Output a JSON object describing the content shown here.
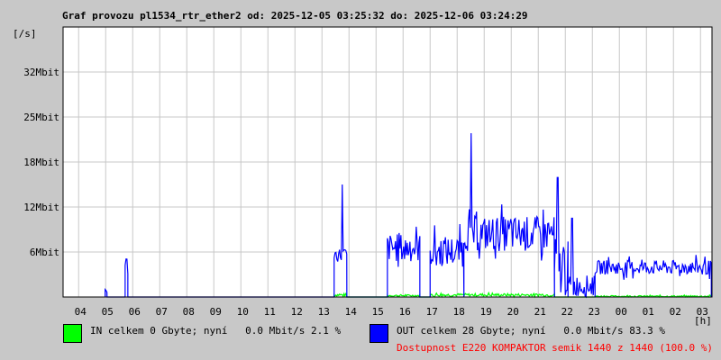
{
  "title": "Graf provozu pl1534_rtr_ether2 od: 2025-12-05 03:25:32 do: 2025-12-06 03:24:29",
  "chart_data": {
    "type": "line",
    "title": "Graf provozu pl1534_rtr_ether2 od: 2025-12-05 03:25:32 do: 2025-12-06 03:24:29",
    "ylabel": "[/s]",
    "xlabel": "[h]",
    "ylim": [
      0,
      38.4
    ],
    "x_start_hour": 3.425,
    "x_span_hours": 24,
    "y_ticks": [
      {
        "value": 6.4,
        "label": "6Mbit"
      },
      {
        "value": 12.8,
        "label": "12Mbit"
      },
      {
        "value": 19.2,
        "label": "18Mbit"
      },
      {
        "value": 25.6,
        "label": "25Mbit"
      },
      {
        "value": 32.0,
        "label": "32Mbit"
      }
    ],
    "x_ticks": [
      "04",
      "05",
      "06",
      "07",
      "08",
      "09",
      "10",
      "11",
      "12",
      "13",
      "14",
      "15",
      "16",
      "17",
      "18",
      "19",
      "20",
      "21",
      "22",
      "23",
      "00",
      "01",
      "02",
      "03"
    ],
    "grid": true,
    "series": [
      {
        "name": "OUT",
        "color": "#0000ff",
        "segments": [
          {
            "from": 4.98,
            "to": 5.05,
            "mean": 1.0,
            "jitter": 0.5
          },
          {
            "from": 5.72,
            "to": 5.82,
            "mean": 4.5,
            "jitter": 1.5
          },
          {
            "from": 13.45,
            "to": 13.92,
            "mean": 6.0,
            "jitter": 1.0
          },
          {
            "from": 15.42,
            "to": 16.62,
            "mean": 7.0,
            "jitter": 2.0
          },
          {
            "from": 17.0,
            "to": 18.25,
            "mean": 6.5,
            "jitter": 2.2
          },
          {
            "from": 18.25,
            "to": 21.6,
            "mean": 9.0,
            "jitter": 2.5
          },
          {
            "from": 21.6,
            "to": 22.1,
            "mean": 4.0,
            "jitter": 4.0
          },
          {
            "from": 22.1,
            "to": 23.1,
            "mean": 1.6,
            "jitter": 1.5
          },
          {
            "from": 23.1,
            "to": 27.4,
            "mean": 4.2,
            "jitter": 1.0
          }
        ],
        "spikes": [
          {
            "t": 13.75,
            "v": 16.0
          },
          {
            "t": 18.52,
            "v": 23.3
          },
          {
            "t": 21.72,
            "v": 17.0
          },
          {
            "t": 22.25,
            "v": 11.2
          }
        ]
      },
      {
        "name": "IN",
        "color": "#00ff00",
        "segments": [
          {
            "from": 13.45,
            "to": 13.92,
            "mean": 0.3,
            "jitter": 0.2
          },
          {
            "from": 15.42,
            "to": 16.62,
            "mean": 0.2,
            "jitter": 0.15
          },
          {
            "from": 17.0,
            "to": 21.6,
            "mean": 0.3,
            "jitter": 0.2
          },
          {
            "from": 23.1,
            "to": 27.4,
            "mean": 0.1,
            "jitter": 0.1
          }
        ],
        "spikes": []
      }
    ]
  },
  "legend": {
    "in_text": "IN celkem 0 Gbyte; nyní   0.0 Mbit/s 2.1 %",
    "out_text": "OUT celkem 28 Gbyte; nyní   0.0 Mbit/s 83.3 %",
    "availability": "Dostupnost E220 KOMPAKTOR semik 1440 z 1440 (100.0 %)",
    "in_color": "#00ff00",
    "out_color": "#0000ff",
    "availability_color": "#ff0000"
  }
}
